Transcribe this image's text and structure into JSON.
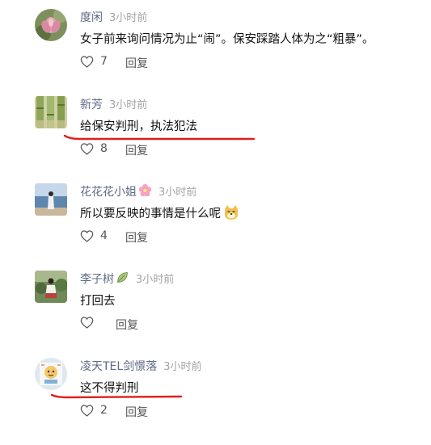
{
  "comments": [
    {
      "username": "度闲",
      "time": "3小时前",
      "text": "女子前来询问情况为止“闹”。保安踩踏人体为之“粗暴”。",
      "likes": "7",
      "reply_label": "回复",
      "avatar": "lotus-flower-avatar"
    },
    {
      "username": "新芳",
      "time": "3小时前",
      "text": "给保安判刑，执法犯法",
      "likes": "8",
      "reply_label": "回复",
      "avatar": "bamboo-avatar"
    },
    {
      "username": "花花花小姐",
      "username_badge": "pink-flower-emoji",
      "time": "3小时前",
      "text": "所以要反映的事情是什么呢",
      "text_emoji": "doge-emoji",
      "likes": "4",
      "reply_label": "回复",
      "avatar": "seaside-photo-avatar"
    },
    {
      "username": "李子树",
      "username_badge": "leaf-emoji",
      "time": "3小时前",
      "text": "打回去",
      "likes": "",
      "reply_label": "回复",
      "avatar": "garden-photo-avatar"
    },
    {
      "username": "凌天TEL剑憬落",
      "time": "3小时前",
      "text": "这不得判刑",
      "likes": "2",
      "reply_label": "回复",
      "avatar": "cartoon-avatar"
    }
  ],
  "annotation_color": "#e0201b",
  "username_color": "#5e6a86"
}
